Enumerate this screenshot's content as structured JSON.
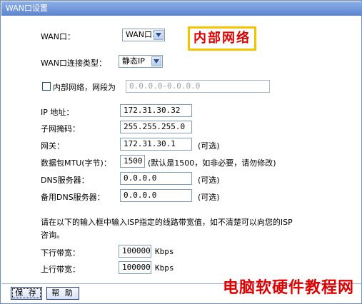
{
  "title": "WAN口设置",
  "wan_port": {
    "label": "WAN口：",
    "value": "WAN口1"
  },
  "badge_text": "内部网络",
  "connection_type": {
    "label": "WAN口连接类型：",
    "value": "静态IP"
  },
  "internal_network": {
    "label": "内部网络，网段为",
    "value": "0.0.0.0-0.0.0.0",
    "checked": false
  },
  "ip": {
    "label": "IP 地址：",
    "value": "172.31.30.32"
  },
  "mask": {
    "label": "子网掩码：",
    "value": "255.255.255.0"
  },
  "gateway": {
    "label": "网关：",
    "value": "172.31.30.1",
    "note": "(可选)"
  },
  "mtu": {
    "label": "数据包MTU(字节)：",
    "value": "1500",
    "note": "(默认是1500，如非必要，请勿修改)"
  },
  "dns": {
    "label": "DNS服务器：",
    "value": "0.0.0.0",
    "note": "(可选)"
  },
  "dns2": {
    "label": "备用DNS服务器：",
    "value": "0.0.0.0",
    "note": "(可选)"
  },
  "bandwidth_note_line1": "请在以下的输入框中输入ISP指定的线路带宽值，如不清楚可以向您的ISP",
  "bandwidth_note_line2": "咨询。",
  "downlink": {
    "label": "下行带宽：",
    "value": "100000",
    "unit": "Kbps"
  },
  "uplink": {
    "label": "上行带宽：",
    "value": "100000",
    "unit": "Kbps"
  },
  "buttons": {
    "save": "保 存",
    "help": "帮 助"
  },
  "watermark": "电脑软硬件教程网"
}
